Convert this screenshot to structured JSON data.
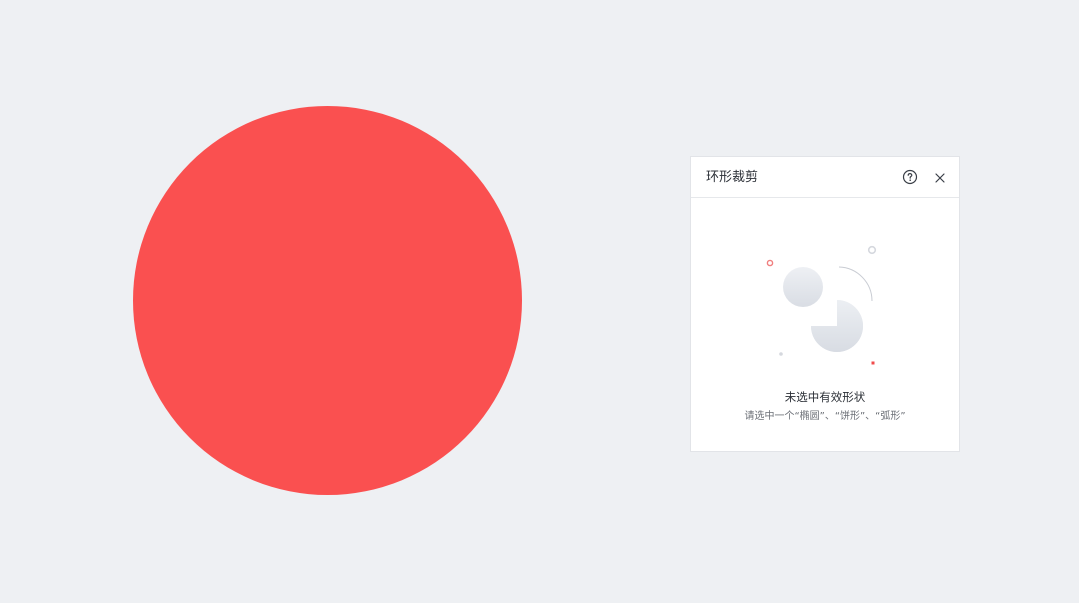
{
  "canvas": {
    "shape_color": "#fa5050",
    "shape_type": "circle"
  },
  "panel": {
    "title": "环形裁剪",
    "help_icon": "help-circle-icon",
    "close_icon": "close-icon",
    "empty_state": {
      "title": "未选中有效形状",
      "description": "请选中一个“椭圆”、“饼形”、“弧形”"
    }
  },
  "colors": {
    "accent": "#fa5050",
    "background": "#eef0f3",
    "panel_bg": "#ffffff",
    "text_primary": "#2b2f36",
    "text_secondary": "#6b6f76"
  }
}
